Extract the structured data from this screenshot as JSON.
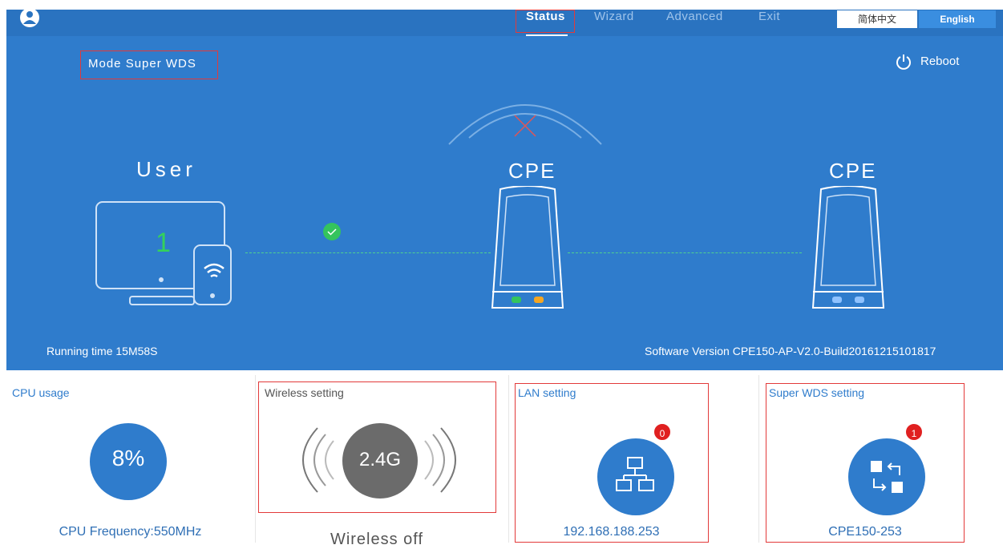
{
  "nav": {
    "status": "Status",
    "wizard": "Wizard",
    "advanced": "Advanced",
    "exit": "Exit"
  },
  "lang": {
    "chinese": "简体中文",
    "english": "English"
  },
  "hero": {
    "mode": "Mode Super WDS",
    "reboot": "Reboot",
    "user_label": "User",
    "user_count": "1",
    "cpe_left": "CPE",
    "cpe_right": "CPE",
    "running_time": "Running time  15M58S",
    "software_version": "Software Version  CPE150-AP-V2.0-Build20161215101817"
  },
  "panels": {
    "cpu": {
      "title": "CPU usage",
      "value": "8%",
      "foot": "CPU Frequency:550MHz"
    },
    "wireless": {
      "title": "Wireless setting",
      "value": "2.4G",
      "foot": "Wireless off"
    },
    "lan": {
      "title": "LAN setting",
      "badge": "0",
      "foot": "192.168.188.253"
    },
    "wds": {
      "title": "Super WDS setting",
      "badge": "1",
      "foot": "CPE150-253"
    }
  },
  "colors": {
    "hero_blue": "#2f7ccc",
    "accent_green": "#34d15b",
    "alert_red": "#e02020",
    "panel_blue": "#2f7ccc",
    "wireless_gray": "#6b6b6b"
  },
  "icons": [
    "logo-icon",
    "power-icon",
    "wifi-signal-icon",
    "check-icon",
    "no-signal-icon",
    "network-icon",
    "wds-icon"
  ]
}
